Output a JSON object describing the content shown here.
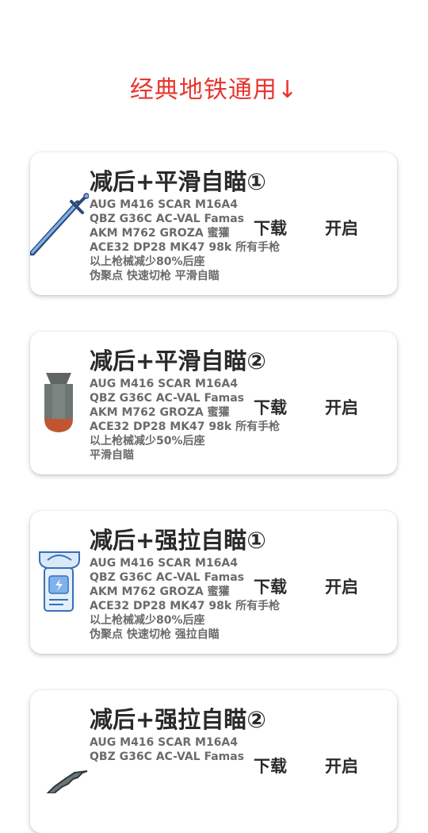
{
  "header": {
    "title": "经典地铁通用↓"
  },
  "cards": [
    {
      "icon": "sword-icon",
      "title": "减后+平滑自瞄①",
      "lines": [
        "AUG  M416  SCAR  M16A4",
        "QBZ  G36C  AC-VAL  Famas",
        "AKM  M762  GROZA  蜜獾",
        "ACE32  DP28  MK47  98k  所有手枪",
        "以上枪械减少80%后座",
        "伪聚点  快速切枪  平滑自瞄"
      ],
      "download_label": "下载",
      "enable_label": "开启"
    },
    {
      "icon": "bomb-icon",
      "title": "减后+平滑自瞄②",
      "lines": [
        "AUG  M416  SCAR  M16A4",
        "QBZ  G36C  AC-VAL  Famas",
        "AKM  M762  GROZA  蜜獾",
        "ACE32  DP28  MK47  98k  所有手枪",
        "以上枪械减少50%后座",
        "平滑自瞄"
      ],
      "download_label": "下载",
      "enable_label": "开启"
    },
    {
      "icon": "battery-icon",
      "title": "减后+强拉自瞄①",
      "lines": [
        "AUG  M416  SCAR  M16A4",
        "QBZ  G36C  AC-VAL  Famas",
        "AKM  M762  GROZA  蜜獾",
        "ACE32  DP28  MK47  98k  所有手枪",
        "以上枪械减少80%后座",
        "伪聚点  快速切枪  强拉自瞄"
      ],
      "download_label": "下载",
      "enable_label": "开启"
    },
    {
      "icon": "knife-icon",
      "title": "减后+强拉自瞄②",
      "lines": [
        "AUG  M416  SCAR  M16A4",
        "QBZ  G36C  AC-VAL  Famas",
        "",
        "",
        "",
        ""
      ],
      "download_label": "下载",
      "enable_label": "开启"
    }
  ]
}
